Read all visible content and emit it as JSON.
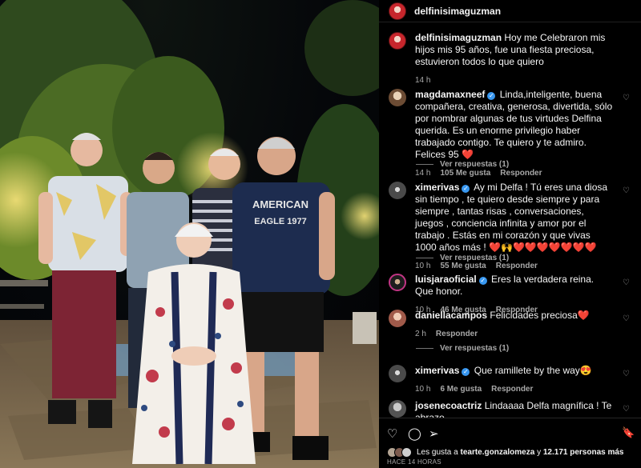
{
  "header": {
    "username": "delfinisimaguzman"
  },
  "caption": {
    "username": "delfinisimaguzman",
    "text": "Hoy me Celebraron mis hijos mis 95 años, fue una fiesta preciosa, estuvieron todos lo que quiero",
    "time": "14 h"
  },
  "comments": [
    {
      "username": "magdamaxneef",
      "text": "Linda,inteligente, buena compañera, creativa, generosa, divertida, sólo por nombrar algunas de tus virtudes Delfina querida. Es un enorme privilegio haber trabajado contigo. Te quiero y te admiro. Felices 95 ❤️",
      "time": "14 h",
      "likes": "105 Me gusta",
      "reply": "Responder",
      "replies": "Ver respuestas (1)"
    },
    {
      "username": "ximerivas",
      "text": "Ay mi Delfa ! Tú eres una diosa sin tiempo , te quiero desde siempre y para siempre , tantas risas , conversaciones, juegos , conciencia infinita y amor por el trabajo . Estás en mi corazón y que vivas 1000 años más ! ❤️🙌❤️❤️❤️❤️❤️❤️❤️",
      "time": "10 h",
      "likes": "55 Me gusta",
      "reply": "Responder",
      "replies": "Ver respuestas (1)"
    },
    {
      "username": "luisjaraoficial",
      "text": "Eres la verdadera reina. Que honor.",
      "time": "10 h",
      "likes": "46 Me gusta",
      "reply": "Responder"
    },
    {
      "username": "daniellacampos",
      "text": "Felicidades preciosa❤️",
      "time": "2 h",
      "reply": "Responder",
      "replies": "Ver respuestas (1)"
    },
    {
      "username": "ximerivas",
      "text": "Que ramillete by the way😍",
      "time": "10 h",
      "likes": "6 Me gusta",
      "reply": "Responder"
    },
    {
      "username": "josenecoactriz",
      "text": "Lindaaaa Delfa magnífica ! Te abrazo"
    }
  ],
  "photo": {
    "shirt_text": "AMERICAN EAGLE 1977"
  },
  "footer": {
    "likes_prefix": "Les gusta a ",
    "likes_user": "tearte.gonzalomeza",
    "likes_middle": " y ",
    "likes_count": "12.171 personas más",
    "timestamp": "HACE 14 HORAS"
  },
  "icons": {
    "heart": "♡",
    "comment": "◯",
    "share": "➢",
    "bookmark": "🔖"
  },
  "colors": {
    "verified": "#3897f0",
    "muted": "#a8a8a8",
    "background": "#000000"
  }
}
